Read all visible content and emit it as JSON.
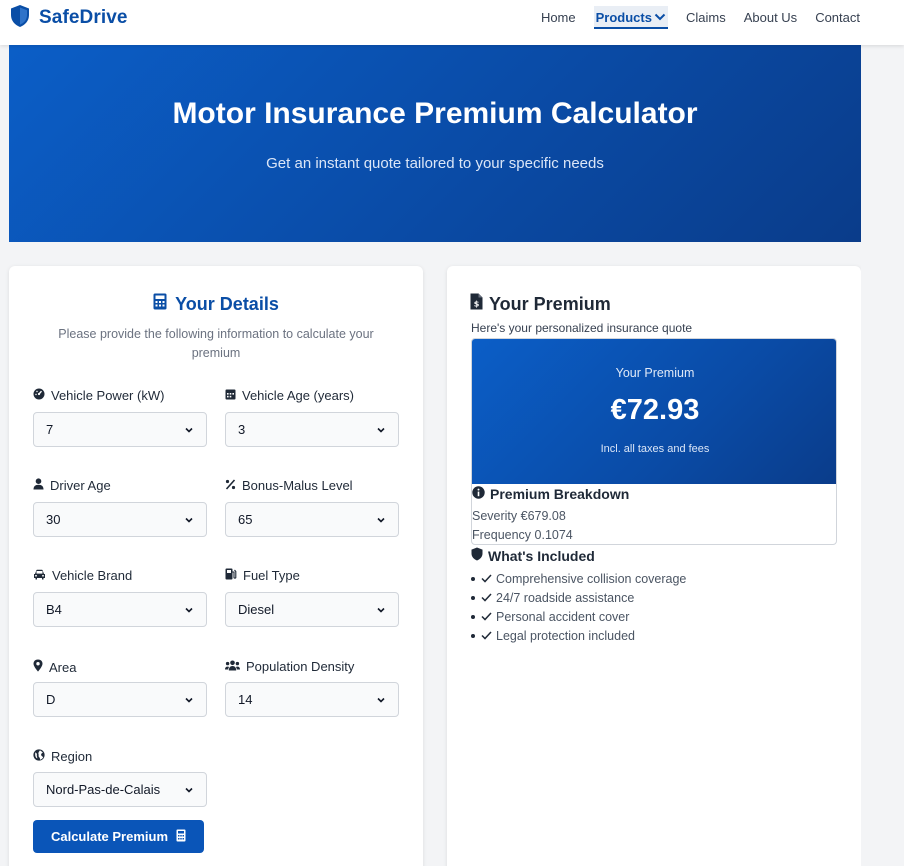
{
  "brand": {
    "name": "SafeDrive",
    "icon": "shield-icon",
    "color": "#0a4ea6"
  },
  "nav": {
    "items": [
      {
        "label": "Home",
        "active": false
      },
      {
        "label": "Products",
        "active": true,
        "has_dropdown": true
      },
      {
        "label": "Claims",
        "active": false
      },
      {
        "label": "About Us",
        "active": false
      },
      {
        "label": "Contact",
        "active": false
      }
    ]
  },
  "hero": {
    "title": "Motor Insurance Premium Calculator",
    "subtitle": "Get an instant quote tailored to your specific needs"
  },
  "details": {
    "title": "Your Details",
    "icon": "calculator-icon",
    "subtitle": "Please provide the following information to calculate your premium",
    "fields": [
      {
        "label": "Vehicle Power (kW)",
        "icon": "gauge-icon",
        "value": "7"
      },
      {
        "label": "Vehicle Age (years)",
        "icon": "calendar-icon",
        "value": "3"
      },
      {
        "label": "Driver Age",
        "icon": "user-icon",
        "value": "30"
      },
      {
        "label": "Bonus-Malus Level",
        "icon": "percent-icon",
        "value": "65"
      },
      {
        "label": "Vehicle Brand",
        "icon": "car-icon",
        "value": "B4"
      },
      {
        "label": "Fuel Type",
        "icon": "fuel-icon",
        "value": "Diesel"
      },
      {
        "label": "Area",
        "icon": "map-pin-icon",
        "value": "D"
      },
      {
        "label": "Population Density",
        "icon": "users-icon",
        "value": "14"
      },
      {
        "label": "Region",
        "icon": "globe-icon",
        "value": "Nord-Pas-de-Calais"
      }
    ],
    "button_label": "Calculate Premium"
  },
  "premium": {
    "title": "Your Premium",
    "icon": "invoice-dollar-icon",
    "subtitle": "Here's your personalized insurance quote",
    "box_label": "Your Premium",
    "amount": "€72.93",
    "note": "Incl. all taxes and fees",
    "breakdown_title": "Premium Breakdown",
    "breakdown": [
      {
        "text": "Severity €679.08"
      },
      {
        "text": "Frequency 0.1074"
      }
    ],
    "included_title": "What's Included",
    "included": [
      "Comprehensive collision coverage",
      "24/7 roadside assistance",
      "Personal accident cover",
      "Legal protection included"
    ]
  },
  "colors": {
    "primary": "#0a4ea6",
    "button": "#0a55b8",
    "hero_start": "#0b5ec7",
    "hero_end": "#0a3c8a"
  }
}
